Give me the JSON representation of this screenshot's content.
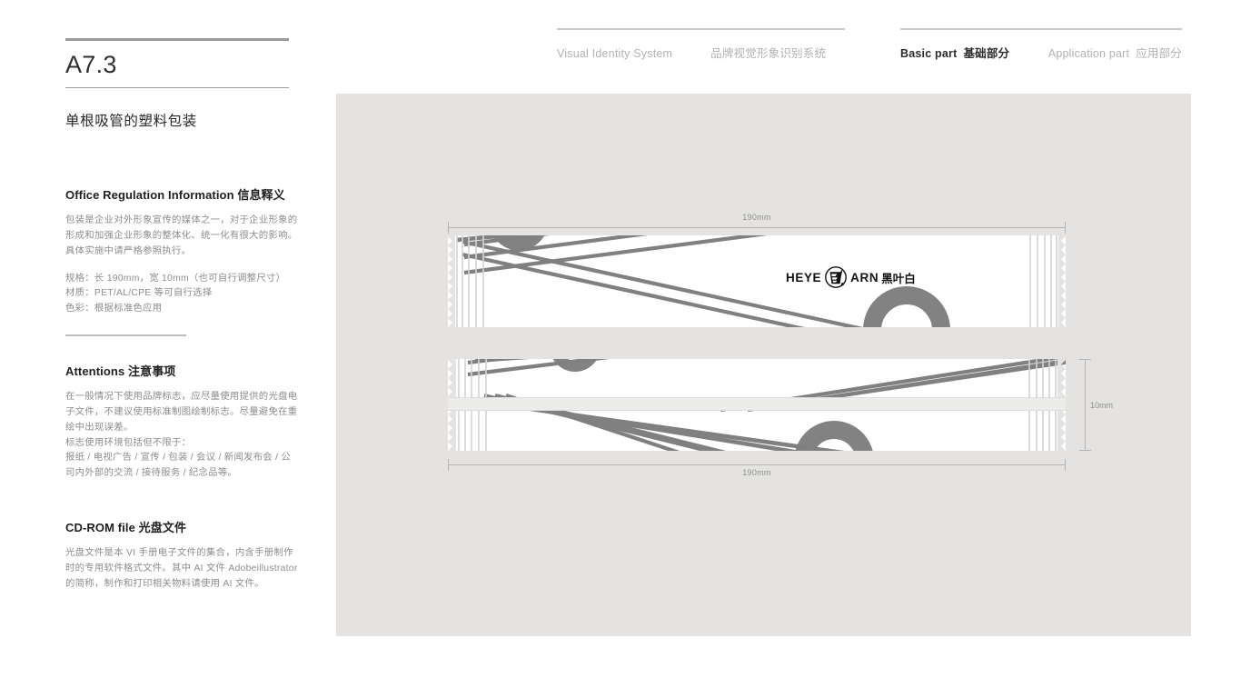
{
  "nav": {
    "left_group": [
      {
        "label": "Visual Identity System",
        "active": false
      },
      {
        "label": "品牌视觉形象识别系统",
        "active": false
      }
    ],
    "right_group": [
      {
        "label_en": "Basic part",
        "label_cn": "基础部分",
        "active": true
      },
      {
        "label_en": "Application part",
        "label_cn": "应用部分",
        "active": false
      }
    ]
  },
  "page": {
    "code": "A7.3",
    "subtitle": "单根吸管的塑料包装"
  },
  "sections": {
    "info": {
      "heading_en": "Office Regulation Information",
      "heading_cn": "信息释义",
      "paragraph": "包装是企业对外形象宣传的媒体之一，对于企业形象的形成和加强企业形象的整体化、统一化有很大的影响。具体实施中请严格参照执行。",
      "spec_size": "规格：长 190mm，宽 10mm（也可自行调整尺寸）",
      "spec_material": "材质：PET/AL/CPE 等可自行选择",
      "spec_color": "色彩：根据标准色应用"
    },
    "attentions": {
      "heading_en": "Attentions",
      "heading_cn": "注意事项",
      "paragraph1": "在一般情况下使用品牌标志，应尽量使用提供的光盘电子文件，不建议使用标准制图绘制标志。尽量避免在重绘中出现误差。",
      "paragraph2": "标志使用环境包括但不限于：",
      "paragraph3": "报纸 / 电视广告 / 宣传 / 包装 / 会议 / 新闻发布会 / 公司内外部的交流 / 接待服务 / 纪念品等。"
    },
    "cdrom": {
      "heading_en": "CD-ROM file",
      "heading_cn": "光盘文件",
      "paragraph": "光盘文件是本 VI 手册电子文件的集合，内含手册制作时的专用软件格式文件。其中 AI 文件 Adobeillustrator 的简称，制作和打印相关物料请使用 AI 文件。"
    }
  },
  "artboard": {
    "dimensions": {
      "top_width": "190mm",
      "bottom_width": "190mm",
      "height": "10mm"
    },
    "logo": {
      "word_left": "HEYE",
      "word_right": "ARN",
      "chinese": "黑叶白",
      "emblem": "cup-leaf-emblem"
    }
  },
  "colors": {
    "canvas_bg": "#e4e3e1",
    "wrapper_bg": "#ffffff",
    "stripe_gray": "#808080",
    "arc_gray": "#828282",
    "dim_line": "#b5b5b5",
    "body_text": "#8d8d8d",
    "heading_text": "#1f1f1f",
    "nav_muted": "#b2b2b2"
  }
}
